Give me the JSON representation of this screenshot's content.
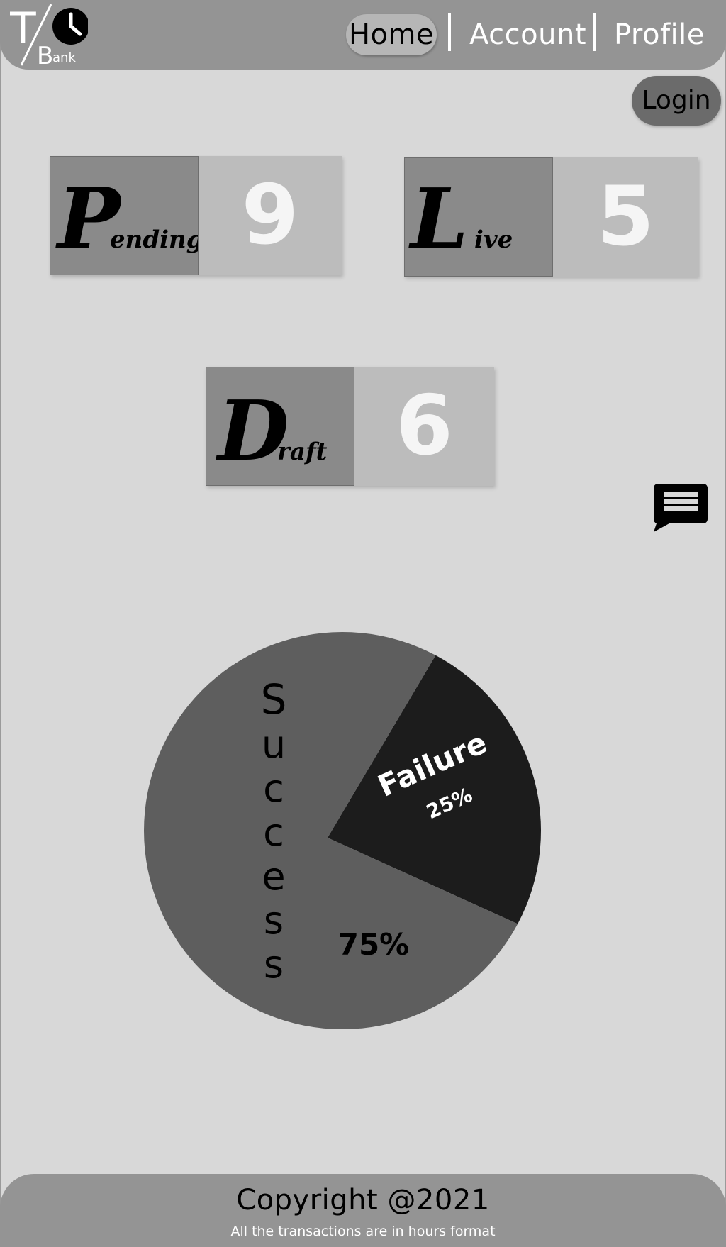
{
  "brand": {
    "logo_top": "T",
    "logo_bottom": "B",
    "logo_suffix": "ank"
  },
  "nav": {
    "home": "Home",
    "account": "Account",
    "profile": "Profile",
    "active": "Home"
  },
  "login_label": "Login",
  "cards": {
    "pending": {
      "initial": "P",
      "rest": "ending",
      "count": "9"
    },
    "live": {
      "initial": "L",
      "rest": "ive",
      "count": "5"
    },
    "draft": {
      "initial": "D",
      "rest": "raft",
      "count": "6"
    }
  },
  "chat_icon": "chat-bubble-icon",
  "chart_data": {
    "type": "pie",
    "slices": [
      {
        "label": "Success",
        "value": 75,
        "value_label": "75%",
        "color": "#5e5e5e"
      },
      {
        "label": "Failure",
        "value": 25,
        "value_label": "25%",
        "color": "#1c1c1c"
      }
    ]
  },
  "footer": {
    "copyright": "Copyright @2021",
    "note": "All the transactions are in hours format"
  }
}
